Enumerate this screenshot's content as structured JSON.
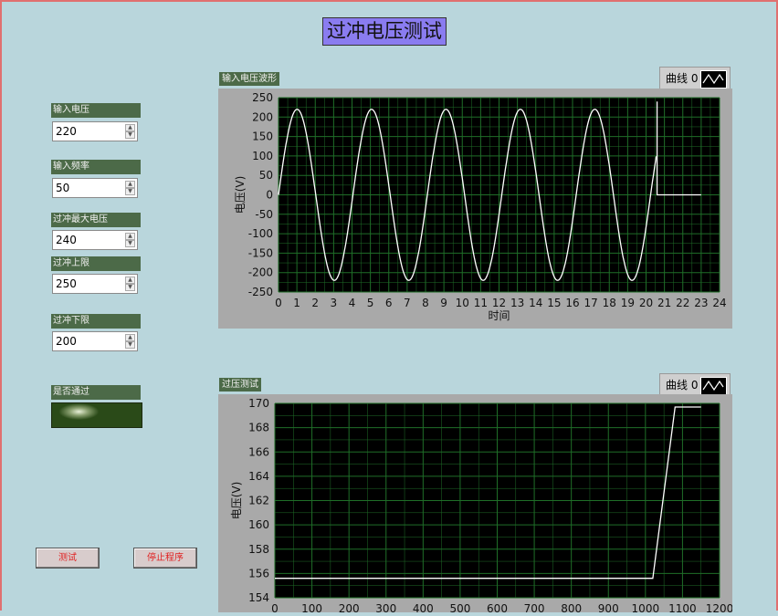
{
  "title": "过冲电压测试",
  "controls": {
    "voltage": {
      "label": "输入电压",
      "value": "220"
    },
    "frequency": {
      "label": "输入频率",
      "value": "50"
    },
    "max_voltage": {
      "label": "过冲最大电压",
      "value": "240"
    },
    "upper": {
      "label": "过冲上限",
      "value": "250"
    },
    "lower": {
      "label": "过冲下限",
      "value": "200"
    },
    "pass": {
      "label": "是否通过"
    }
  },
  "buttons": {
    "test": "测试",
    "stop": "停止程序"
  },
  "colors": {
    "background": "#b9d6dc",
    "plot_bg": "#000000",
    "grid": "#1f6e28",
    "trace": "#ffffff",
    "label_bg": "#4c6a48",
    "title_bg": "#8a7cf0",
    "button_text": "#e02020"
  },
  "chart_data": [
    {
      "type": "line",
      "title": "输入电压波形",
      "legend": "曲线 0",
      "xlabel": "时间",
      "ylabel": "电压(V)",
      "xlim": [
        0,
        24
      ],
      "ylim": [
        -250,
        250
      ],
      "xticks": [
        0,
        1,
        2,
        3,
        4,
        5,
        6,
        7,
        8,
        9,
        10,
        11,
        12,
        13,
        14,
        15,
        16,
        17,
        18,
        19,
        20,
        21,
        22,
        23,
        24
      ],
      "yticks": [
        -250,
        -200,
        -150,
        -100,
        -50,
        0,
        50,
        100,
        150,
        200,
        250
      ],
      "series": [
        {
          "amplitude": 220,
          "period": 4.05,
          "x_end": 20.6,
          "spike_peak": 240,
          "tail_x_end": 23
        }
      ]
    },
    {
      "type": "line",
      "title": "过压测试",
      "legend": "曲线 0",
      "xlabel": "",
      "ylabel": "电压(V)",
      "xlim": [
        0,
        1200
      ],
      "ylim": [
        154,
        170
      ],
      "xticks": [
        0,
        100,
        200,
        300,
        400,
        500,
        600,
        700,
        800,
        900,
        1000,
        1100,
        1200
      ],
      "yticks": [
        154,
        156,
        158,
        160,
        162,
        164,
        166,
        168,
        170
      ],
      "series": [
        {
          "x": [
            0,
            1020,
            1080,
            1150
          ],
          "y": [
            155.6,
            155.6,
            169.7,
            169.7
          ]
        }
      ]
    }
  ]
}
